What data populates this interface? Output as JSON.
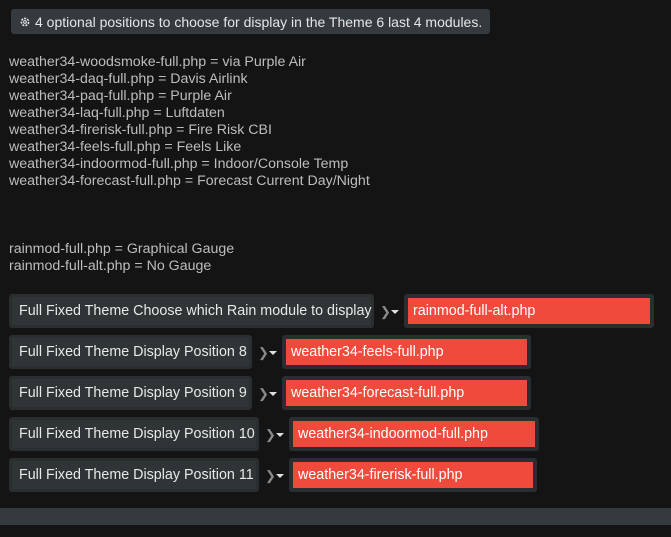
{
  "notice": {
    "icon": "gear-icon",
    "text": "4 optional positions to choose for display in the Theme 6 last 4 modules."
  },
  "module_list": [
    "weather34-woodsmoke-full.php = via Purple Air",
    "weather34-daq-full.php = Davis Airlink",
    "weather34-paq-full.php = Purple Air",
    "weather34-laq-full.php = Luftdaten",
    "weather34-firerisk-full.php = Fire Risk CBI",
    "weather34-feels-full.php = Feels Like",
    "weather34-indoormod-full.php = Indoor/Console Temp",
    "weather34-forecast-full.php = Forecast Current Day/Night"
  ],
  "rain_list": [
    "rainmod-full.php = Graphical Gauge",
    "rainmod-full-alt.php = No Gauge"
  ],
  "settings": [
    {
      "label": "Full Fixed Theme Choose which Rain module to display",
      "value": "rainmod-full-alt.php"
    },
    {
      "label": "Full Fixed Theme Display Position 8",
      "value": "weather34-feels-full.php"
    },
    {
      "label": "Full Fixed Theme Display Position 9",
      "value": "weather34-forecast-full.php"
    },
    {
      "label": "Full Fixed Theme Display Position 10",
      "value": "weather34-indoormod-full.php"
    },
    {
      "label": "Full Fixed Theme Display Position 11",
      "value": "weather34-firerisk-full.php"
    }
  ],
  "colors": {
    "background": "#141414",
    "select_fill": "#f04a3c",
    "label_box": "#2f3437"
  }
}
